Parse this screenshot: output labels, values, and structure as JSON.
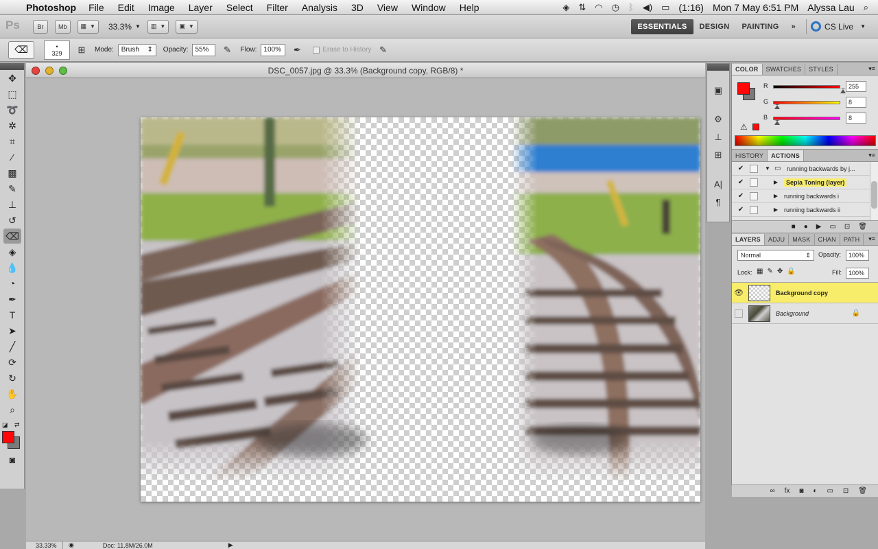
{
  "menubar": {
    "app_name": "Photoshop",
    "menus": [
      "File",
      "Edit",
      "Image",
      "Layer",
      "Select",
      "Filter",
      "Analysis",
      "3D",
      "View",
      "Window",
      "Help"
    ],
    "battery": "(1:16)",
    "datetime": "Mon 7 May  6:51 PM",
    "user": "Alyssa Lau"
  },
  "appbar": {
    "logo": "Ps",
    "bridge": "Br",
    "minibridge": "Mb",
    "zoom": "33.3%",
    "workspaces": [
      "ESSENTIALS",
      "DESIGN",
      "PAINTING"
    ],
    "more": "»",
    "cslive": "CS Live"
  },
  "options": {
    "brush_size": "329",
    "mode_label": "Mode:",
    "mode_value": "Brush",
    "opacity_label": "Opacity:",
    "opacity_value": "55%",
    "flow_label": "Flow:",
    "flow_value": "100%",
    "erase_history": "Erase to History"
  },
  "document": {
    "title": "DSC_0057.jpg @ 33.3% (Background copy, RGB/8) *",
    "zoom_status": "33.33%",
    "doc_info": "Doc: 11.8M/26.0M"
  },
  "color_panel": {
    "tabs": [
      "COLOR",
      "SWATCHES",
      "STYLES"
    ],
    "r_label": "R",
    "g_label": "G",
    "b_label": "B",
    "r_value": "255",
    "g_value": "8",
    "b_value": "8",
    "foreground": "#ff0808",
    "background": "#7a7a7a"
  },
  "actions_panel": {
    "tabs": [
      "HISTORY",
      "ACTIONS"
    ],
    "set_name": "running backwards by j...",
    "items": [
      "Sepia Toning (layer)",
      "running backwards i",
      "running backwards ii"
    ]
  },
  "layers_panel": {
    "tabs": [
      "LAYERS",
      "ADJU",
      "MASK",
      "CHAN",
      "PATH"
    ],
    "blend_mode": "Normal",
    "opacity_label": "Opacity:",
    "opacity_value": "100%",
    "lock_label": "Lock:",
    "fill_label": "Fill:",
    "fill_value": "100%",
    "layers": [
      "Background copy",
      "Background"
    ]
  },
  "colors": {
    "selected_highlight": "#f7ed6b",
    "accent_red": "#ff0808"
  }
}
